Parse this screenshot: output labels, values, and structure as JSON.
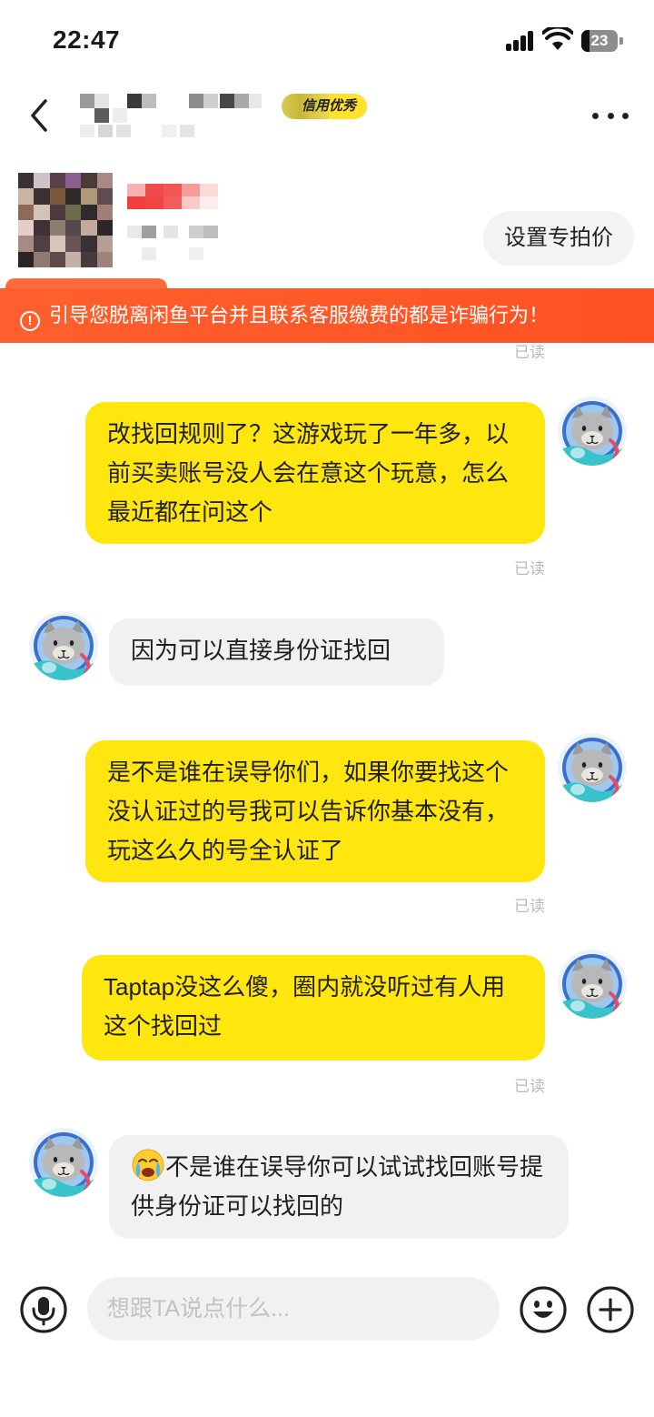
{
  "status_bar": {
    "time": "22:47",
    "battery": "23"
  },
  "header": {
    "back_icon": "chevron-left-icon",
    "credit_badge": "信用优秀",
    "more_icon": "more-dots-icon"
  },
  "product": {
    "special_price_button": "设置专拍价"
  },
  "warning": {
    "icon": "alert-circle-icon",
    "text": "引导您脱离闲鱼平台并且联系客服缴费的都是诈骗行为！"
  },
  "read_status": "已读",
  "messages": [
    {
      "sender": "me",
      "text": "改找回规则了？这游戏玩了一年多，以前买卖账号没人会在意这个玩意，怎么最近都在问这个",
      "status": "已读"
    },
    {
      "sender": "other",
      "text": "因为可以直接身份证找回"
    },
    {
      "sender": "me",
      "text": "是不是谁在误导你们，如果你要找这个没认证过的号我可以告诉你基本没有，玩这么久的号全认证了",
      "status": "已读"
    },
    {
      "sender": "me",
      "text": "Taptap没这么傻，圈内就没听过有人用这个找回过",
      "status": "已读"
    },
    {
      "sender": "other",
      "emoji": "crying-face-emoji",
      "text": "不是谁在误导你可以试试找回账号提供身份证可以找回的"
    }
  ],
  "input_bar": {
    "voice_icon": "microphone-icon",
    "placeholder": "想跟TA说点什么...",
    "emoji_icon": "smiley-icon",
    "plus_icon": "plus-icon"
  },
  "colors": {
    "my_bubble": "#ffe60f",
    "other_bubble": "#f1f1f4",
    "warning_banner": "#ff5a28",
    "credit_badge": "#ffe22b"
  }
}
